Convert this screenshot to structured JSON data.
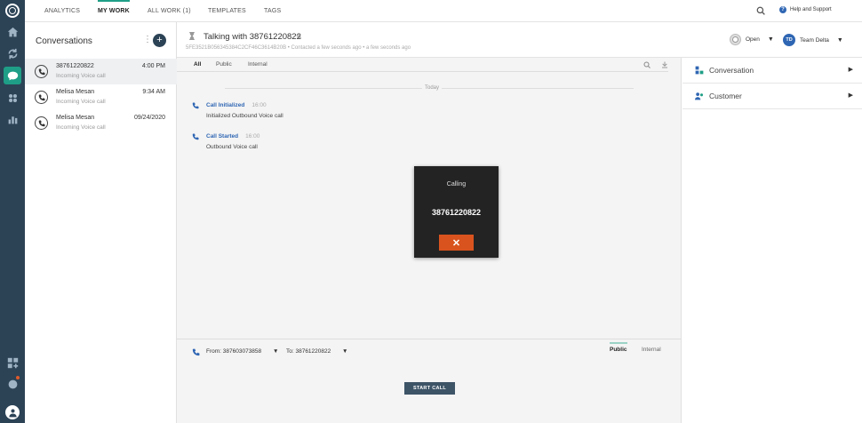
{
  "nav": {
    "tabs": [
      {
        "label": "ANALYTICS"
      },
      {
        "label": "MY WORK"
      },
      {
        "label": "ALL WORK (1)"
      },
      {
        "label": "TEMPLATES"
      },
      {
        "label": "TAGS"
      }
    ],
    "help_label": "Help and Support",
    "help_glyph": "?"
  },
  "conversations": {
    "title": "Conversations",
    "more_glyph": "⋮",
    "add_glyph": "+",
    "items": [
      {
        "name": "38761220822",
        "subtitle": "Incoming Voice call",
        "time": "4:00 PM"
      },
      {
        "name": "Melisa Mesan",
        "subtitle": "Incoming Voice call",
        "time": "9:34 AM"
      },
      {
        "name": "Melisa Mesan",
        "subtitle": "Incoming Voice call",
        "time": "09/24/2020"
      }
    ]
  },
  "header": {
    "title": "Talking with 38761220822",
    "pencil_glyph": "✎",
    "subtitle": "5FE3521B056345384C2CF46C3614B20B • Contacted a few seconds ago • a few seconds ago",
    "status": "Open",
    "team_initials": "TD",
    "team_name": "Team Delta",
    "caret": "▼"
  },
  "timeline": {
    "filters": [
      {
        "label": "All"
      },
      {
        "label": "Public"
      },
      {
        "label": "Internal"
      }
    ],
    "day_label": "Today",
    "events": [
      {
        "title": "Call Initialized",
        "time": "16:00",
        "description": "Initialized Outbound Voice call"
      },
      {
        "title": "Call Started",
        "time": "16:00",
        "description": "Outbound Voice call"
      }
    ]
  },
  "call_modal": {
    "label": "Calling",
    "number": "38761220822",
    "hangup_glyph": "✕"
  },
  "composer": {
    "from": "From: 387603073858",
    "to": "To: 38761220822",
    "caret": "▼",
    "tabs": [
      {
        "label": "Public"
      },
      {
        "label": "Internal"
      }
    ],
    "start_call_label": "START CALL"
  },
  "right_panel": {
    "items": [
      {
        "label": "Conversation",
        "arrow": "▶"
      },
      {
        "label": "Customer",
        "arrow": "▶"
      }
    ]
  }
}
